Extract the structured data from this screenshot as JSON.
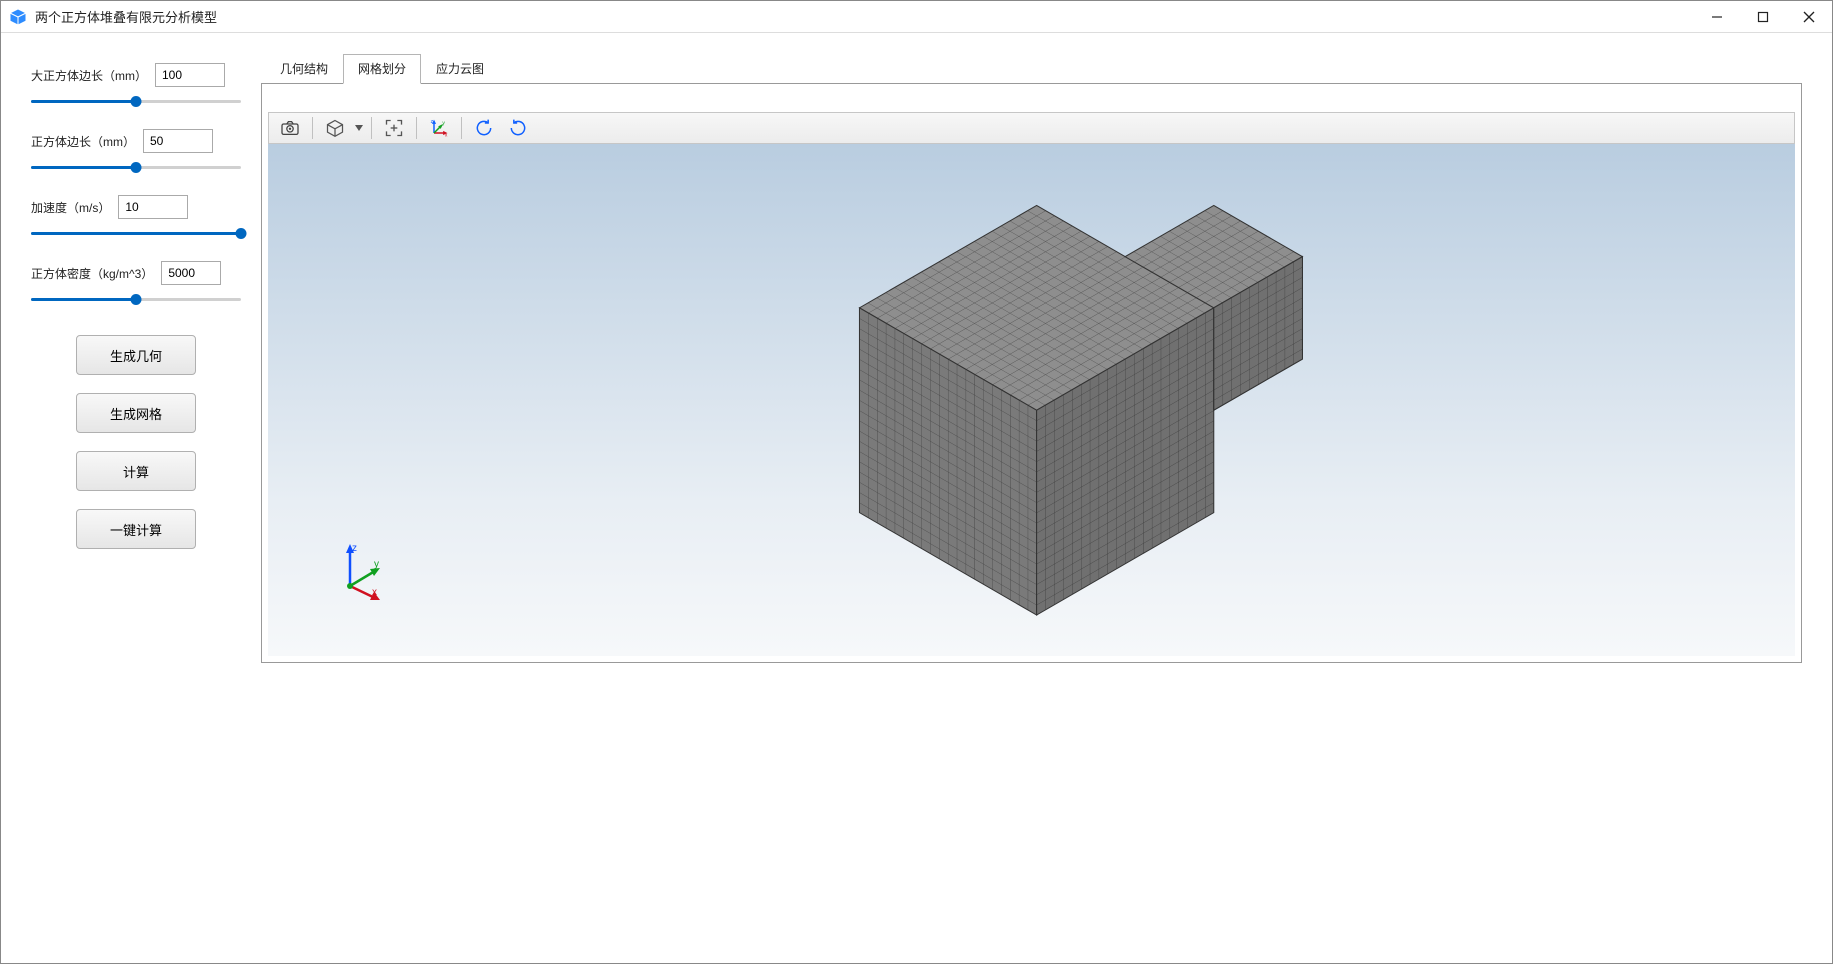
{
  "window": {
    "title": "两个正方体堆叠有限元分析模型"
  },
  "params": {
    "big_edge": {
      "label": "大正方体边长（mm）",
      "value": "100",
      "slider_pct": 50
    },
    "small_edge": {
      "label": "正方体边长（mm）",
      "value": "50",
      "slider_pct": 50
    },
    "accel": {
      "label": "加速度（m/s）",
      "value": "10",
      "slider_pct": 100
    },
    "density": {
      "label": "正方体密度（kg/m^3）",
      "value": "5000",
      "slider_pct": 50
    }
  },
  "buttons": {
    "gen_geom": "生成几何",
    "gen_mesh": "生成网格",
    "compute": "计算",
    "one_click": "一键计算"
  },
  "tabs": {
    "geometry": "几何结构",
    "mesh": "网格划分",
    "contour": "应力云图",
    "active": "mesh"
  },
  "toolbar_icons": {
    "camera": "camera-icon",
    "cube_view": "cube-view-icon",
    "fit": "fit-view-icon",
    "axis_xy": "axis-toggle-icon",
    "rot_ccw": "rotate-ccw-icon",
    "rot_cw": "rotate-cw-icon"
  },
  "triad": {
    "x": "x",
    "y": "y",
    "z": "z"
  }
}
